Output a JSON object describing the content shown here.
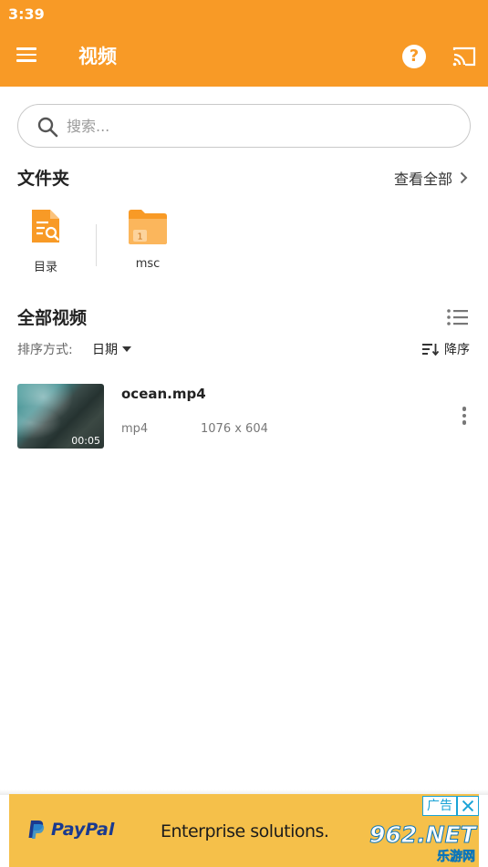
{
  "status_bar": {
    "time": "3:39"
  },
  "app_bar": {
    "title": "视频",
    "help_label": "?"
  },
  "search": {
    "placeholder": "搜索..."
  },
  "folders": {
    "title": "文件夹",
    "view_all": "查看全部",
    "items": [
      {
        "label": "目录",
        "icon": "folder-search-icon"
      },
      {
        "label": "msc",
        "icon": "folder-icon",
        "badge": "1"
      }
    ]
  },
  "videos": {
    "title": "全部视频",
    "sort_label": "排序方式:",
    "sort_value": "日期",
    "sort_order": "降序",
    "items": [
      {
        "name": "ocean.mp4",
        "format": "mp4",
        "resolution": "1076 x 604",
        "duration": "00:05"
      }
    ]
  },
  "ad": {
    "brand": "PayPal",
    "tagline": "Enterprise solutions.",
    "label": "广告"
  },
  "watermark": {
    "number": "962",
    "suffix": ".NET",
    "sub": "乐游网"
  },
  "colors": {
    "accent": "#f89a26",
    "ad_background": "#f5c04a",
    "paypal_blue": "#1a3a8f"
  }
}
